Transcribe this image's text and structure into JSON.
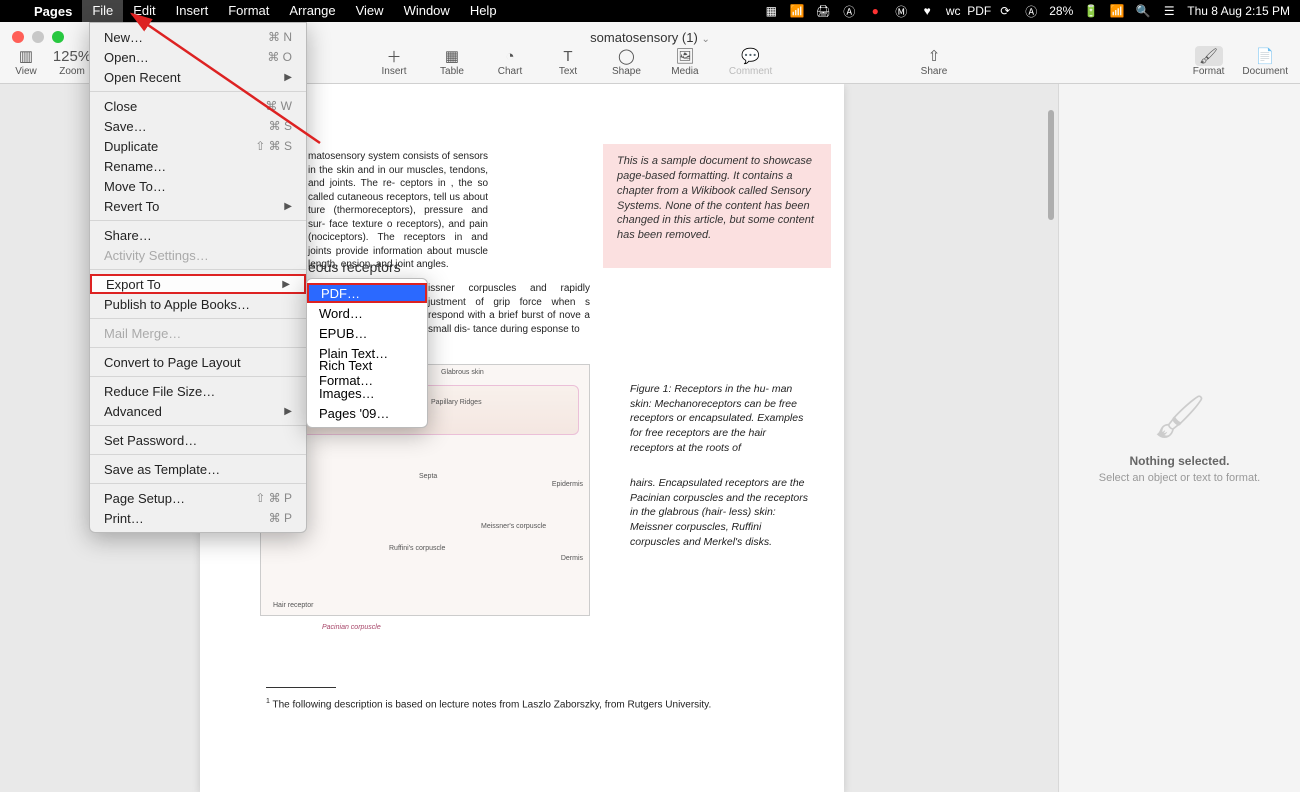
{
  "menubar": {
    "app": "Pages",
    "items": [
      "File",
      "Edit",
      "Insert",
      "Format",
      "Arrange",
      "View",
      "Window",
      "Help"
    ],
    "status": {
      "battery": "28%",
      "clock": "Thu 8 Aug  2:15 PM"
    }
  },
  "window": {
    "title": "somatosensory (1)",
    "traffic": {
      "close": "#ff5f57",
      "min": "#c8c8c8",
      "max": "#28c840"
    }
  },
  "toolbar": {
    "left": [
      {
        "label": "View"
      },
      {
        "label": "Zoom",
        "value": "125%"
      }
    ],
    "center": [
      {
        "label": "Insert"
      },
      {
        "label": "Table"
      },
      {
        "label": "Chart"
      },
      {
        "label": "Text"
      },
      {
        "label": "Shape"
      },
      {
        "label": "Media"
      },
      {
        "label": "Comment",
        "disabled": true
      }
    ],
    "share": "Share",
    "right": [
      {
        "label": "Format",
        "selected": true
      },
      {
        "label": "Document"
      }
    ]
  },
  "file_menu": [
    {
      "label": "New…",
      "shortcut": "⌘ N"
    },
    {
      "label": "Open…",
      "shortcut": "⌘ O"
    },
    {
      "label": "Open Recent",
      "submenu": true
    },
    {
      "sep": true
    },
    {
      "label": "Close",
      "shortcut": "⌘ W"
    },
    {
      "label": "Save…",
      "shortcut": "⌘ S"
    },
    {
      "label": "Duplicate",
      "shortcut": "⇧ ⌘ S"
    },
    {
      "label": "Rename…"
    },
    {
      "label": "Move To…"
    },
    {
      "label": "Revert To",
      "submenu": true
    },
    {
      "sep": true
    },
    {
      "label": "Share…"
    },
    {
      "label": "Activity Settings…",
      "disabled": true
    },
    {
      "sep": true
    },
    {
      "label": "Export To",
      "submenu": true,
      "highlight": true
    },
    {
      "label": "Publish to Apple Books…"
    },
    {
      "sep": true
    },
    {
      "label": "Mail Merge…",
      "disabled": true
    },
    {
      "sep": true
    },
    {
      "label": "Convert to Page Layout"
    },
    {
      "sep": true
    },
    {
      "label": "Reduce File Size…"
    },
    {
      "label": "Advanced",
      "submenu": true
    },
    {
      "sep": true
    },
    {
      "label": "Set Password…"
    },
    {
      "sep": true
    },
    {
      "label": "Save as Template…"
    },
    {
      "sep": true
    },
    {
      "label": "Page Setup…",
      "shortcut": "⇧ ⌘ P"
    },
    {
      "label": "Print…",
      "shortcut": "⌘ P"
    }
  ],
  "export_submenu": [
    "PDF…",
    "Word…",
    "EPUB…",
    "Plain Text…",
    "Rich Text Format…",
    "Images…",
    "Pages '09…"
  ],
  "doc": {
    "para1": "matosensory system consists of sensors in the skin and in our muscles, tendons, and joints. The re- ceptors in , the so called cutaneous receptors, tell us about ture (thermoreceptors), pressure and sur- face texture o receptors), and pain (nociceptors). The receptors in and joints provide information about muscle length, ension, and joint angles.",
    "heading": "eous receptors",
    "para2": "issner corpuscles and rapidly justment of grip force when s respond with a brief burst of nove a small dis- tance during esponse  to",
    "callout": "This is a sample document to showcase page-based formatting. It contains a chapter from a Wikibook called Sensory Systems. None of the content has been changed in this article, but some content has been removed.",
    "fig_labels": {
      "gs": "Glabrous skin",
      "pr": "Papillary Ridges",
      "ep": "Epidermis",
      "de": "Dermis",
      "se": "Septa",
      "hr": "Hair receptor",
      "rc": "Ruffini's corpuscle",
      "mc": "Meissner's corpuscle"
    },
    "figcap1": "Figure 1: Receptors in the hu- man skin: Mechanoreceptors can be free receptors or encapsulated. Examples for free receptors are the hair receptors at the roots of",
    "figcap2": "hairs. Encapsulated receptors are the Pacinian corpuscles and the receptors in the glabrous (hair- less) skin: Meissner corpuscles, Ruffini corpuscles and Merkel's disks.",
    "small": "Pacinian corpuscle",
    "foot": "The following description is based on lecture notes from Laszlo Zaborszky, from Rutgers University."
  },
  "inspector": {
    "t1": "Nothing selected.",
    "t2": "Select an object or text to format."
  }
}
